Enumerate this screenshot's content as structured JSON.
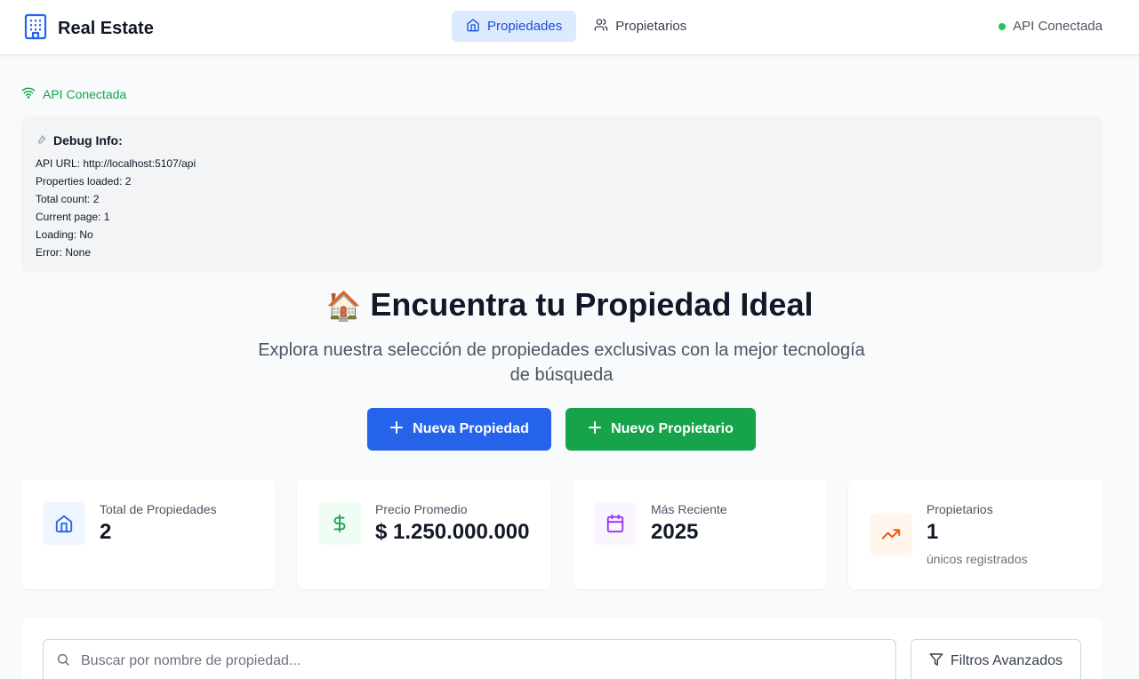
{
  "header": {
    "brand": "Real Estate",
    "brand_icon": "building-icon",
    "nav": [
      {
        "label": "Propiedades",
        "icon": "home-icon",
        "active": true
      },
      {
        "label": "Propietarios",
        "icon": "users-icon",
        "active": false
      }
    ],
    "api_status": "API Conectada"
  },
  "connection": {
    "label": "API Conectada",
    "icon": "wifi-icon",
    "color": "#16a34a"
  },
  "debug": {
    "title": "Debug Info:",
    "lines": [
      "API URL: http://localhost:5107/api",
      "Properties loaded: 2",
      "Total count: 2",
      "Current page: 1",
      "Loading: No",
      "Error: None"
    ]
  },
  "hero": {
    "emoji": "🏠",
    "title": "Encuentra tu Propiedad Ideal",
    "subtitle": "Explora nuestra selección de propiedades exclusivas con la mejor tecnología de búsqueda",
    "new_property": "Nueva Propiedad",
    "new_owner": "Nuevo Propietario"
  },
  "stats": [
    {
      "label": "Total de Propiedades",
      "value": "2",
      "note": "",
      "icon": "home-icon",
      "color": "#2563eb"
    },
    {
      "label": "Precio Promedio",
      "value": "$ 1.250.000.000",
      "note": "",
      "icon": "dollar-icon",
      "color": "#16a34a"
    },
    {
      "label": "Más Reciente",
      "value": "2025",
      "note": "",
      "icon": "calendar-icon",
      "color": "#9333ea"
    },
    {
      "label": "Propietarios",
      "value": "1",
      "note": "únicos registrados",
      "icon": "trending-up-icon",
      "color": "#ea580c"
    }
  ],
  "search": {
    "placeholder": "Buscar por nombre de propiedad...",
    "value": "",
    "filters_label": "Filtros Avanzados"
  },
  "colors": {
    "primary": "#2563eb",
    "success": "#16a34a",
    "nav_active_bg": "#dbeafe"
  }
}
